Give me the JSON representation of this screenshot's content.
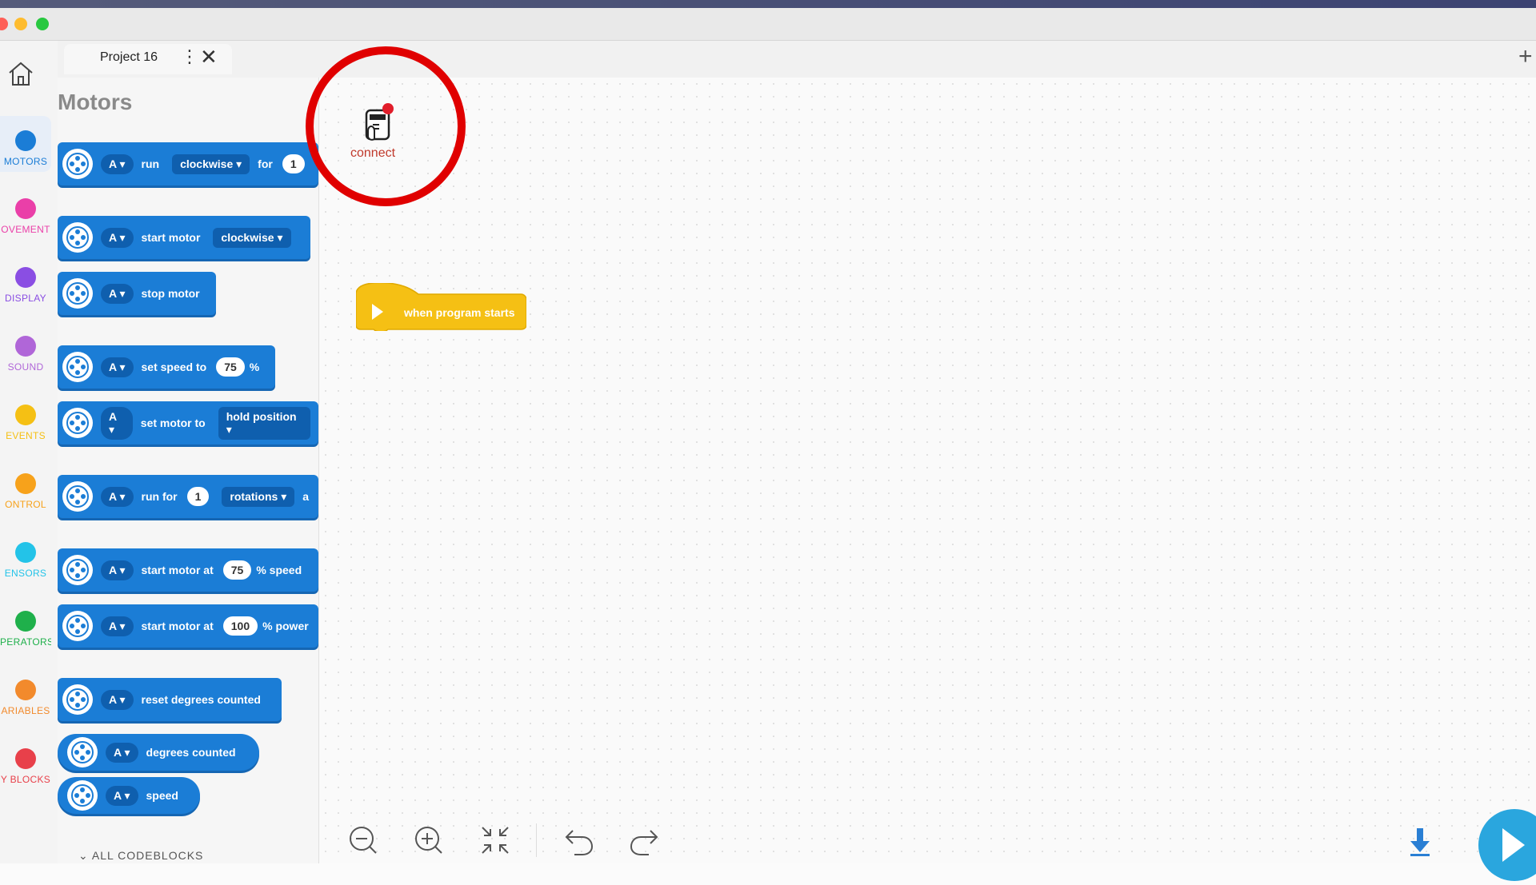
{
  "tab": {
    "title": "Project 16",
    "menu_glyph": "⋮",
    "close_glyph": "✕",
    "new_tab_glyph": "+"
  },
  "categories": [
    {
      "label": "MOTORS",
      "color": "#1b7dd6",
      "active": true
    },
    {
      "label": "OVEMENT",
      "color": "#ea3fa8",
      "active": false
    },
    {
      "label": "DISPLAY",
      "color": "#8a4ee3",
      "active": false
    },
    {
      "label": "SOUND",
      "color": "#b066d8",
      "active": false
    },
    {
      "label": "EVENTS",
      "color": "#f5c014",
      "active": false
    },
    {
      "label": "ONTROL",
      "color": "#f7a21b",
      "active": false
    },
    {
      "label": "ENSORS",
      "color": "#23c3e8",
      "active": false
    },
    {
      "label": "PERATORS",
      "color": "#1fb04b",
      "active": false
    },
    {
      "label": "ARIABLES",
      "color": "#f28a2c",
      "active": false
    },
    {
      "label": "Y BLOCKS",
      "color": "#e8404a",
      "active": false
    }
  ],
  "palette": {
    "title": "Motors",
    "blocks": {
      "b1": {
        "port": "A",
        "t1": "run",
        "d1": "clockwise",
        "t2": "for",
        "n1": "1"
      },
      "b2": {
        "port": "A",
        "t1": "start motor",
        "d1": "clockwise"
      },
      "b3": {
        "port": "A",
        "t1": "stop motor"
      },
      "b4": {
        "port": "A",
        "t1": "set speed to",
        "n1": "75",
        "t2": "%"
      },
      "b5": {
        "port": "A",
        "t1": "set motor to",
        "d1": "hold position"
      },
      "b6": {
        "port": "A",
        "t1": "run for",
        "n1": "1",
        "d1": "rotations",
        "t2": "a"
      },
      "b7": {
        "port": "A",
        "t1": "start motor at",
        "n1": "75",
        "t2": "% speed"
      },
      "b8": {
        "port": "A",
        "t1": "start motor at",
        "n1": "100",
        "t2": "% power"
      },
      "b9": {
        "port": "A",
        "t1": "reset degrees counted"
      },
      "b10": {
        "port": "A",
        "t1": "degrees counted"
      },
      "b11": {
        "port": "A",
        "t1": "speed"
      }
    },
    "all_codeblocks": "ALL CODEBLOCKS"
  },
  "canvas": {
    "connect_label": "connect",
    "hat_block_label": "when program starts"
  },
  "icons": [
    "home-icon",
    "motor-icon",
    "hub-icon",
    "zoom-out-icon",
    "zoom-in-icon",
    "fit-icon",
    "undo-icon",
    "redo-icon",
    "download-icon",
    "play-icon"
  ]
}
